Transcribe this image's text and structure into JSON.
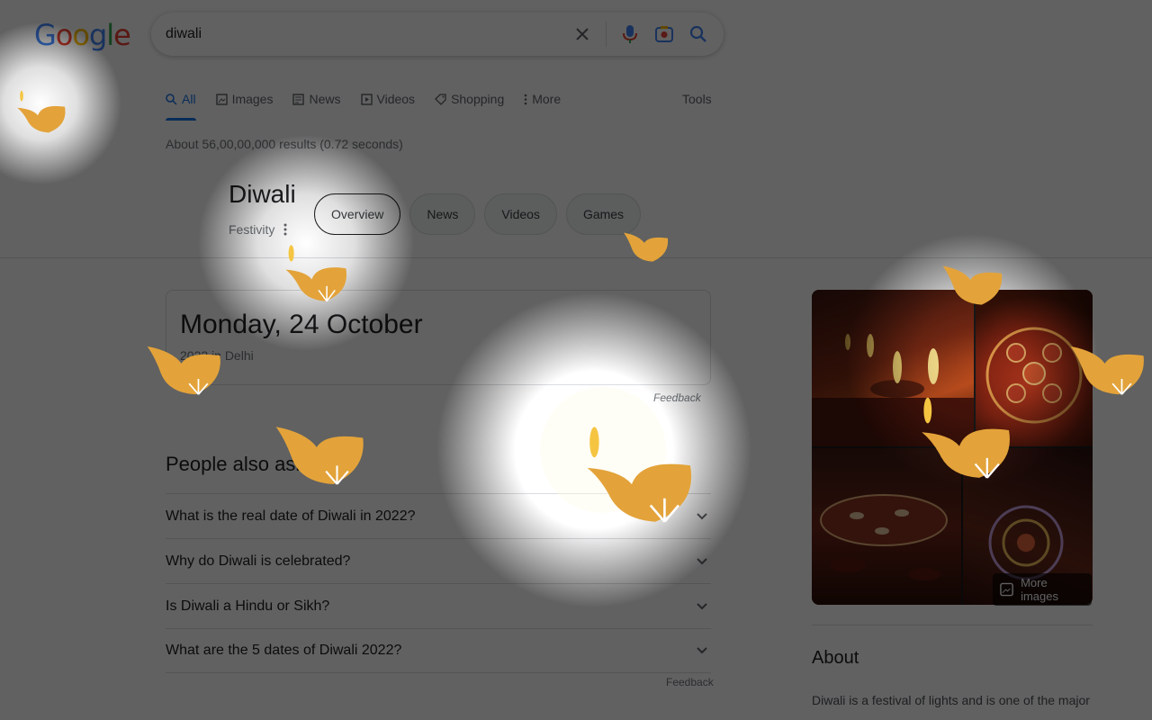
{
  "header": {
    "logo_letters": [
      "G",
      "o",
      "o",
      "g",
      "l",
      "e"
    ],
    "logo_colors": [
      "#4285f4",
      "#ea4335",
      "#fbbc05",
      "#4285f4",
      "#34a853",
      "#ea4335"
    ],
    "search_query": "diwali",
    "clear_icon": "close-icon",
    "mic_icon": "mic-icon",
    "lens_icon": "camera-icon",
    "search_icon": "search-icon"
  },
  "tabs": [
    {
      "label": "All",
      "icon": "search-icon",
      "active": true
    },
    {
      "label": "Images",
      "icon": "image-icon"
    },
    {
      "label": "News",
      "icon": "news-icon"
    },
    {
      "label": "Videos",
      "icon": "video-icon"
    },
    {
      "label": "Shopping",
      "icon": "tag-icon"
    },
    {
      "label": "More",
      "icon": "more-vert-icon"
    }
  ],
  "tools_label": "Tools",
  "results_stats": "About 56,00,00,000 results (0.72 seconds)",
  "entity": {
    "title": "Diwali",
    "subtitle": "Festivity",
    "chips": [
      "Overview",
      "News",
      "Videos",
      "Games"
    ]
  },
  "date_card": {
    "date": "Monday, 24 October",
    "detail": "2022 in Delhi",
    "feedback": "Feedback"
  },
  "people_also_ask": {
    "title": "People also ask",
    "questions": [
      "What is the real date of Diwali in 2022?",
      "Why do Diwali is celebrated?",
      "Is Diwali a Hindu or Sikh?",
      "What are the 5 dates of Diwali 2022?"
    ],
    "feedback": "Feedback"
  },
  "knowledge_panel": {
    "more_images": "More images",
    "about_title": "About",
    "about_text": "Diwali is a festival of lights and is one of the major"
  },
  "accent_colors": {
    "blue": "#1a73e8",
    "diya_gold": "#e3a33a",
    "flame": "#f5c542"
  }
}
